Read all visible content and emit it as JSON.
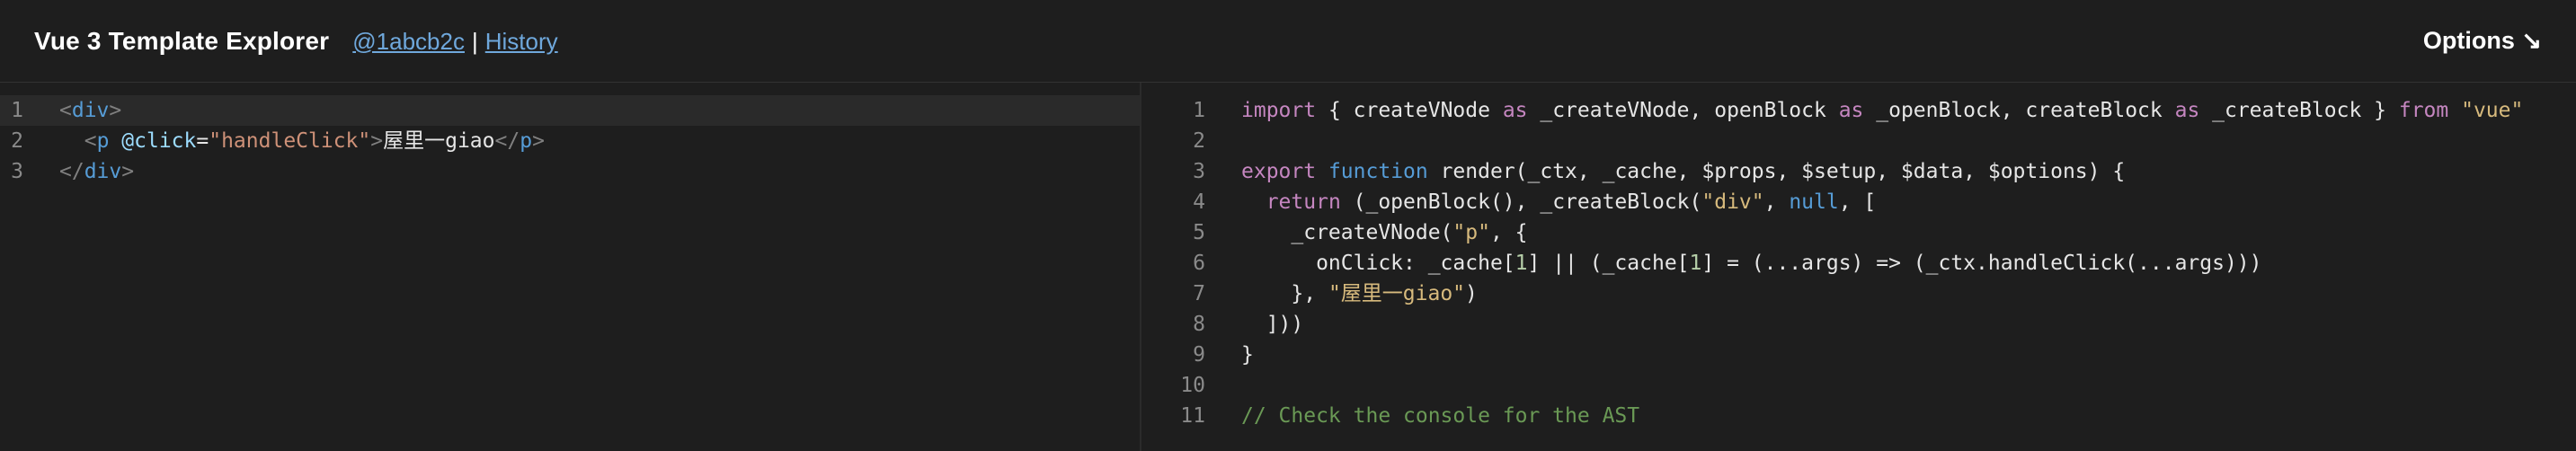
{
  "header": {
    "title": "Vue 3 Template Explorer",
    "commit_link": "@1abcb2c",
    "separator": "|",
    "history_link": "History",
    "options_label": "Options ↘"
  },
  "source": {
    "lines": [
      {
        "num": "1",
        "tokens": [
          [
            "tk-punc",
            "<"
          ],
          [
            "tk-tag",
            "div"
          ],
          [
            "tk-punc",
            ">"
          ]
        ]
      },
      {
        "num": "2",
        "tokens": [
          [
            "tk-text",
            "  "
          ],
          [
            "tk-punc",
            "<"
          ],
          [
            "tk-tag",
            "p"
          ],
          [
            "tk-text",
            " "
          ],
          [
            "tk-attr",
            "@click"
          ],
          [
            "tk-text",
            "="
          ],
          [
            "tk-str",
            "\"handleClick\""
          ],
          [
            "tk-punc",
            ">"
          ],
          [
            "tk-text",
            "屋里一giao"
          ],
          [
            "tk-punc",
            "</"
          ],
          [
            "tk-tag",
            "p"
          ],
          [
            "tk-punc",
            ">"
          ]
        ]
      },
      {
        "num": "3",
        "tokens": [
          [
            "tk-punc",
            "</"
          ],
          [
            "tk-tag",
            "div"
          ],
          [
            "tk-punc",
            ">"
          ]
        ]
      }
    ]
  },
  "output": {
    "lines": [
      {
        "num": "1",
        "tokens": [
          [
            "tk-kw",
            "import"
          ],
          [
            "tk-id",
            " { createVNode "
          ],
          [
            "tk-kw",
            "as"
          ],
          [
            "tk-id",
            " _createVNode, openBlock "
          ],
          [
            "tk-kw",
            "as"
          ],
          [
            "tk-id",
            " _openBlock, createBlock "
          ],
          [
            "tk-kw",
            "as"
          ],
          [
            "tk-id",
            " _createBlock } "
          ],
          [
            "tk-kw",
            "from"
          ],
          [
            "tk-id",
            " "
          ],
          [
            "tk-str2",
            "\"vue\""
          ]
        ]
      },
      {
        "num": "2",
        "tokens": []
      },
      {
        "num": "3",
        "tokens": [
          [
            "tk-kw",
            "export"
          ],
          [
            "tk-id",
            " "
          ],
          [
            "tk-kw2",
            "function"
          ],
          [
            "tk-id",
            " render(_ctx, _cache, $props, $setup, $data, $options) {"
          ]
        ]
      },
      {
        "num": "4",
        "tokens": [
          [
            "tk-id",
            "  "
          ],
          [
            "tk-kw",
            "return"
          ],
          [
            "tk-id",
            " (_openBlock(), _createBlock("
          ],
          [
            "tk-str2",
            "\"div\""
          ],
          [
            "tk-id",
            ", "
          ],
          [
            "tk-kw2",
            "null"
          ],
          [
            "tk-id",
            ", ["
          ]
        ]
      },
      {
        "num": "5",
        "tokens": [
          [
            "tk-id",
            "    _createVNode("
          ],
          [
            "tk-str2",
            "\"p\""
          ],
          [
            "tk-id",
            ", {"
          ]
        ]
      },
      {
        "num": "6",
        "tokens": [
          [
            "tk-id",
            "      onClick: _cache["
          ],
          [
            "tk-num",
            "1"
          ],
          [
            "tk-id",
            "] || (_cache["
          ],
          [
            "tk-num",
            "1"
          ],
          [
            "tk-id",
            "] = (...args) => (_ctx.handleClick(...args)))"
          ]
        ]
      },
      {
        "num": "7",
        "tokens": [
          [
            "tk-id",
            "    }, "
          ],
          [
            "tk-str2",
            "\"屋里一giao\""
          ],
          [
            "tk-id",
            ")"
          ]
        ]
      },
      {
        "num": "8",
        "tokens": [
          [
            "tk-id",
            "  ]))"
          ]
        ]
      },
      {
        "num": "9",
        "tokens": [
          [
            "tk-id",
            "}"
          ]
        ]
      },
      {
        "num": "10",
        "tokens": []
      },
      {
        "num": "11",
        "tokens": [
          [
            "tk-com",
            "// Check the console for the AST"
          ]
        ]
      }
    ]
  }
}
